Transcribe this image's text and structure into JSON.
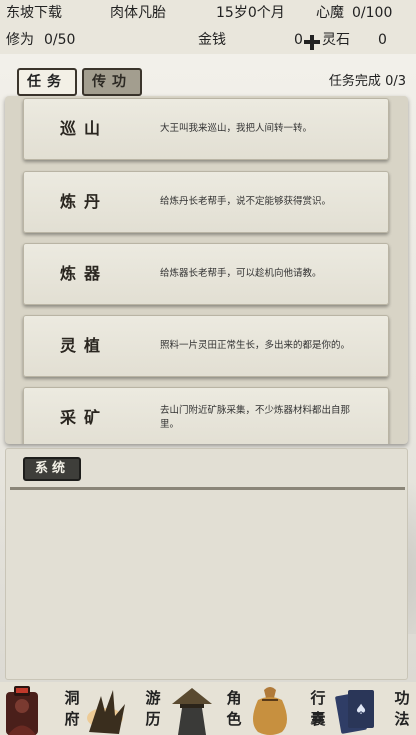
{
  "status": {
    "location": "东坡下载",
    "realm": "肉体凡胎",
    "age": "15岁0个月",
    "heart_demon_label": "心魔",
    "heart_demon_value": "0/100",
    "cultivation_label": "修为",
    "cultivation_value": "0/50",
    "money_label": "金钱",
    "money_value": "0",
    "spirit_stone_label": "灵石",
    "spirit_stone_value": "0"
  },
  "tabs": [
    {
      "label": "任务",
      "selected": true
    },
    {
      "label": "传功",
      "selected": false
    }
  ],
  "task_status": {
    "label": "任务完成",
    "value": "0/3"
  },
  "tasks": [
    {
      "name": "巡山",
      "desc": "大王叫我来巡山，我把人间转一转。"
    },
    {
      "name": "炼丹",
      "desc": "给炼丹长老帮手，说不定能够获得赏识。"
    },
    {
      "name": "炼器",
      "desc": "给炼器长老帮手，可以趁机向他请教。"
    },
    {
      "name": "灵植",
      "desc": "照料一片灵田正常生长，多出来的都是你的。"
    },
    {
      "name": "采矿",
      "desc": "去山门附近矿脉采集，不少炼器材料都出自那里。"
    }
  ],
  "log": {
    "button_label": "系统"
  },
  "nav": [
    {
      "line1": "洞",
      "line2": "府",
      "icon": "cave-dwelling-icon"
    },
    {
      "line1": "游",
      "line2": "历",
      "icon": "travel-icon"
    },
    {
      "line1": "角",
      "line2": "色",
      "icon": "character-icon"
    },
    {
      "line1": "行",
      "line2": "囊",
      "icon": "bag-icon"
    },
    {
      "line1": "功",
      "line2": "法",
      "icon": "technique-icon"
    }
  ],
  "colors": {
    "accent": "#3b352c",
    "panel": "#d8d4c6",
    "nav_bg": "#e6e2d6"
  }
}
